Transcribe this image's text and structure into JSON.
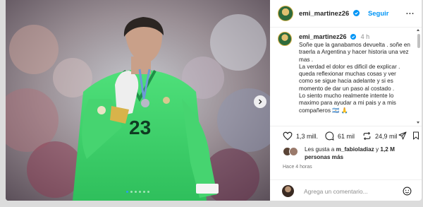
{
  "post": {
    "username": "emi_martinez26",
    "follow_label": "Seguir",
    "more_glyph": "...",
    "verified_icon": "verified-badge-icon",
    "brand_color": "#0095f6"
  },
  "media": {
    "jersey_number": "23",
    "slide_count": 6,
    "active_slide": 0
  },
  "caption": {
    "username": "emi_martinez26",
    "time": "4 h",
    "lines": [
      "Soñe que la ganabamos devuelta . soñe en traerla a Argentina y hacer historia una vez mas .",
      "La verdad el dolor es dificil de explicar . queda reflexionar muchas cosas y ver como se sigue hacia adelante y si es momento de dar un paso al costado .",
      "Lo siento mucho realmente intente lo maximo para ayudar a mi pais y a mis compañeros 🇦🇷 🙏"
    ]
  },
  "actions": {
    "likes_count": "1,3 mill.",
    "comments_count": "61 mil",
    "reposts_count": "24,9 mil",
    "icons": [
      "heart-icon",
      "comment-icon",
      "repost-icon",
      "share-icon",
      "bookmark-icon"
    ]
  },
  "likes": {
    "prefix": "Les gusta a ",
    "user": "m_fabioladiaz",
    "middle": " y ",
    "others": "1,2 M personas más"
  },
  "posted_ago": "Hace 4 horas",
  "comment": {
    "placeholder": "Agrega un comentario...",
    "emoji_icon": "emoji-icon"
  }
}
